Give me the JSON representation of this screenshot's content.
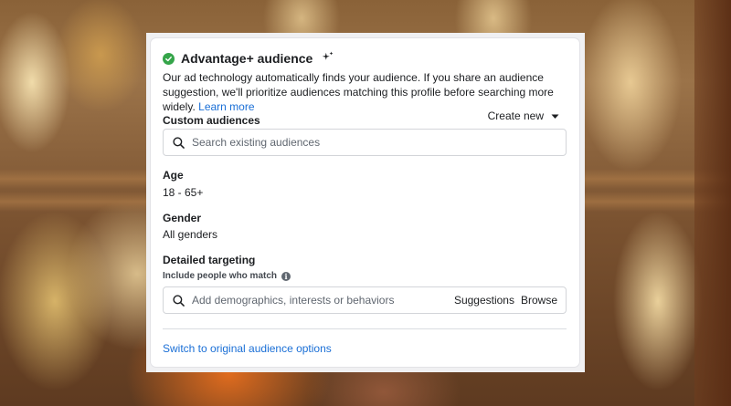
{
  "card": {
    "title": "Advantage+ audience",
    "description": "Our ad technology automatically finds your audience. If you share an audience suggestion, we'll prioritize audiences matching this profile before searching more widely.",
    "learn_more": "Learn more"
  },
  "custom_audiences": {
    "label": "Custom audiences",
    "create_new": "Create new",
    "search_placeholder": "Search existing audiences"
  },
  "age": {
    "label": "Age",
    "value": "18 - 65+"
  },
  "gender": {
    "label": "Gender",
    "value": "All genders"
  },
  "detailed_targeting": {
    "label": "Detailed targeting",
    "sub_label": "Include people who match",
    "search_placeholder": "Add demographics, interests or behaviors",
    "suggestions": "Suggestions",
    "browse": "Browse"
  },
  "switch_link": "Switch to original audience options",
  "icons": [
    "check-circle-icon",
    "sparkle-icon",
    "caret-down-icon",
    "search-icon",
    "info-icon"
  ],
  "colors": {
    "link": "#1a6fd6",
    "success": "#35a54a",
    "text": "#1c1e21",
    "border": "#d3d5d9"
  }
}
